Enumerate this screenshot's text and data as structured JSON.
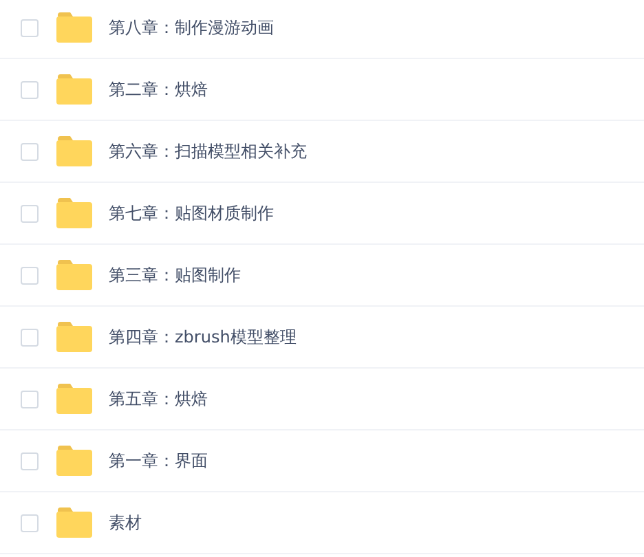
{
  "files": [
    {
      "name": "第八章：制作漫游动画",
      "checked": false
    },
    {
      "name": "第二章：烘焙",
      "checked": false
    },
    {
      "name": "第六章：扫描模型相关补充",
      "checked": false
    },
    {
      "name": "第七章：贴图材质制作",
      "checked": false
    },
    {
      "name": "第三章：贴图制作",
      "checked": false
    },
    {
      "name": "第四章：zbrush模型整理",
      "checked": false
    },
    {
      "name": "第五章：烘焙",
      "checked": false
    },
    {
      "name": "第一章：界面",
      "checked": false
    },
    {
      "name": "素材",
      "checked": false
    }
  ]
}
